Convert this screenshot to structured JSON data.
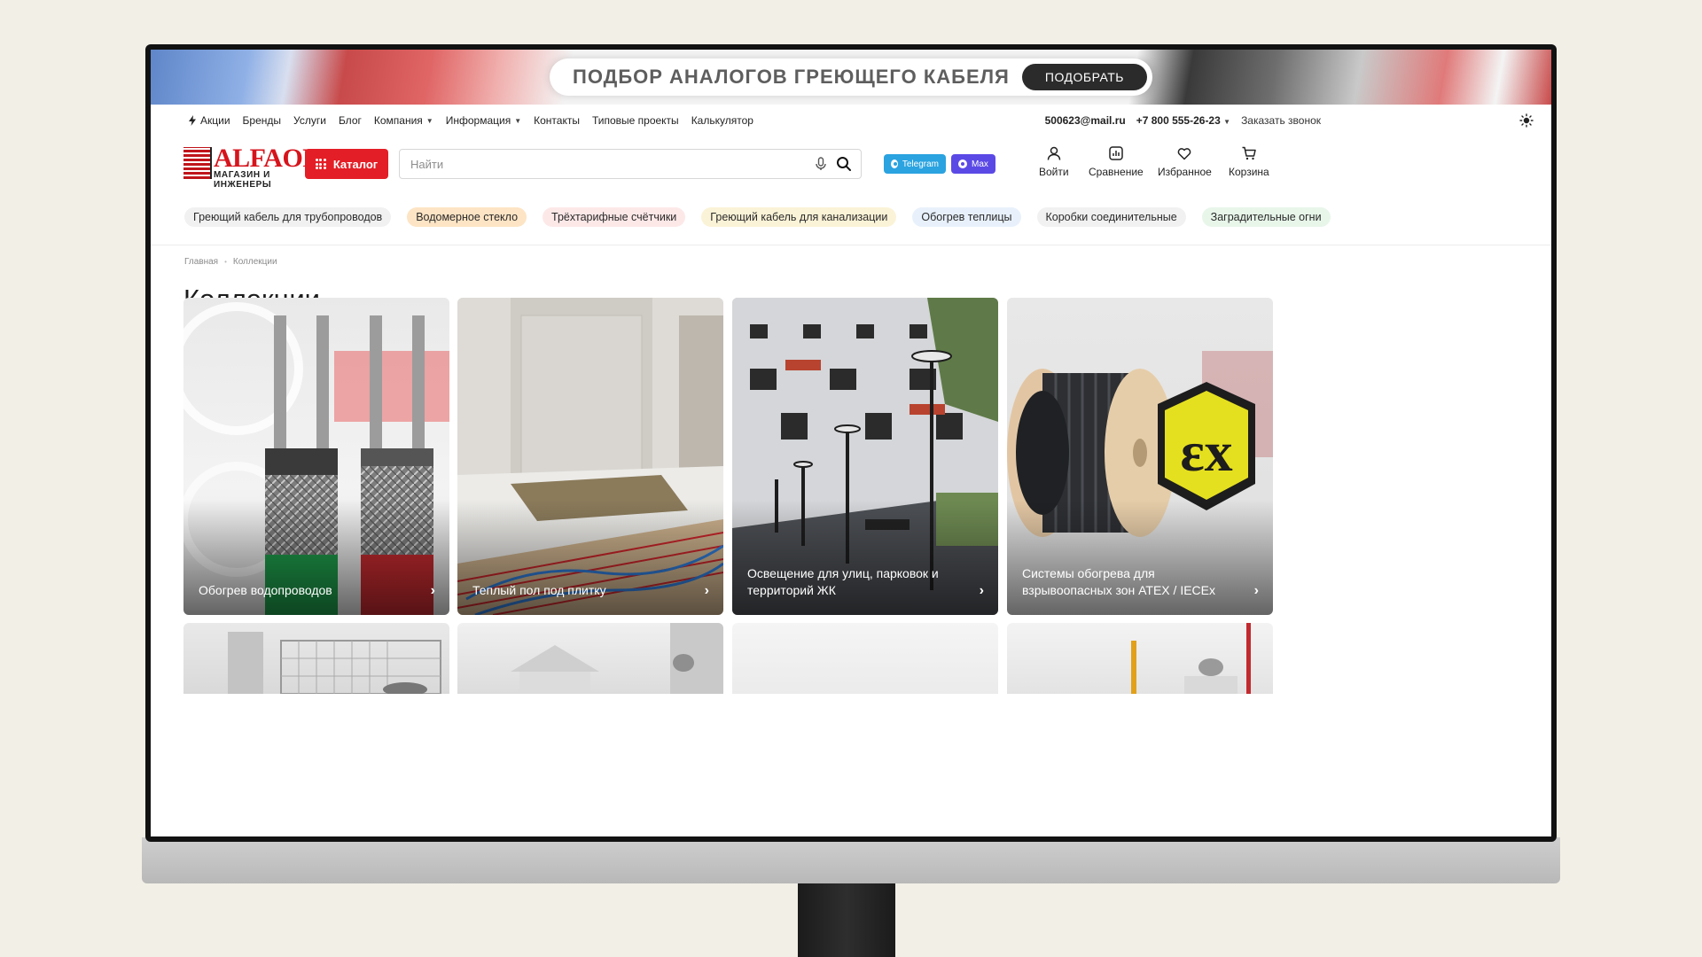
{
  "banner": {
    "text": "ПОДБОР АНАЛОГОВ ГРЕЮЩЕГО КАБЕЛЯ",
    "button": "ПОДОБРАТЬ"
  },
  "topnav": {
    "items": [
      "Акции",
      "Бренды",
      "Услуги",
      "Блог",
      "Компания",
      "Информация",
      "Контакты",
      "Типовые проекты",
      "Калькулятор"
    ],
    "email": "500623@mail.ru",
    "phone": "+7 800 555-26-23",
    "callback": "Заказать звонок"
  },
  "logo": {
    "main": "ALFAOPT",
    "sub": "МАГАЗИН И ИНЖЕНЕРЫ"
  },
  "header": {
    "catalog": "Каталог",
    "search_placeholder": "Найти",
    "telegram": "Telegram",
    "max": "Max",
    "actions": [
      "Войти",
      "Сравнение",
      "Избранное",
      "Корзина"
    ]
  },
  "chips": [
    "Греющий кабель для трубопроводов",
    "Водомерное стекло",
    "Трёхтарифные счётчики",
    "Греющий кабель для канализации",
    "Обогрев теплицы",
    "Коробки соединительные",
    "Заградительные огни"
  ],
  "chip_colors": [
    "#f1f1f1",
    "#fde4c4",
    "#fde8e8",
    "#fbf3d7",
    "#e8f1fb",
    "#f1f1f1",
    "#e8f6ea"
  ],
  "breadcrumb": [
    "Главная",
    "Коллекции"
  ],
  "page_title": "Коллекции",
  "cards": [
    "Обогрев водопроводов",
    "Теплый пол под плитку",
    "Освещение для улиц, парковок и территорий ЖК",
    "Системы обогрева для взрывоопасных зон ATEX / IECEx"
  ],
  "accent": "#e41e26"
}
